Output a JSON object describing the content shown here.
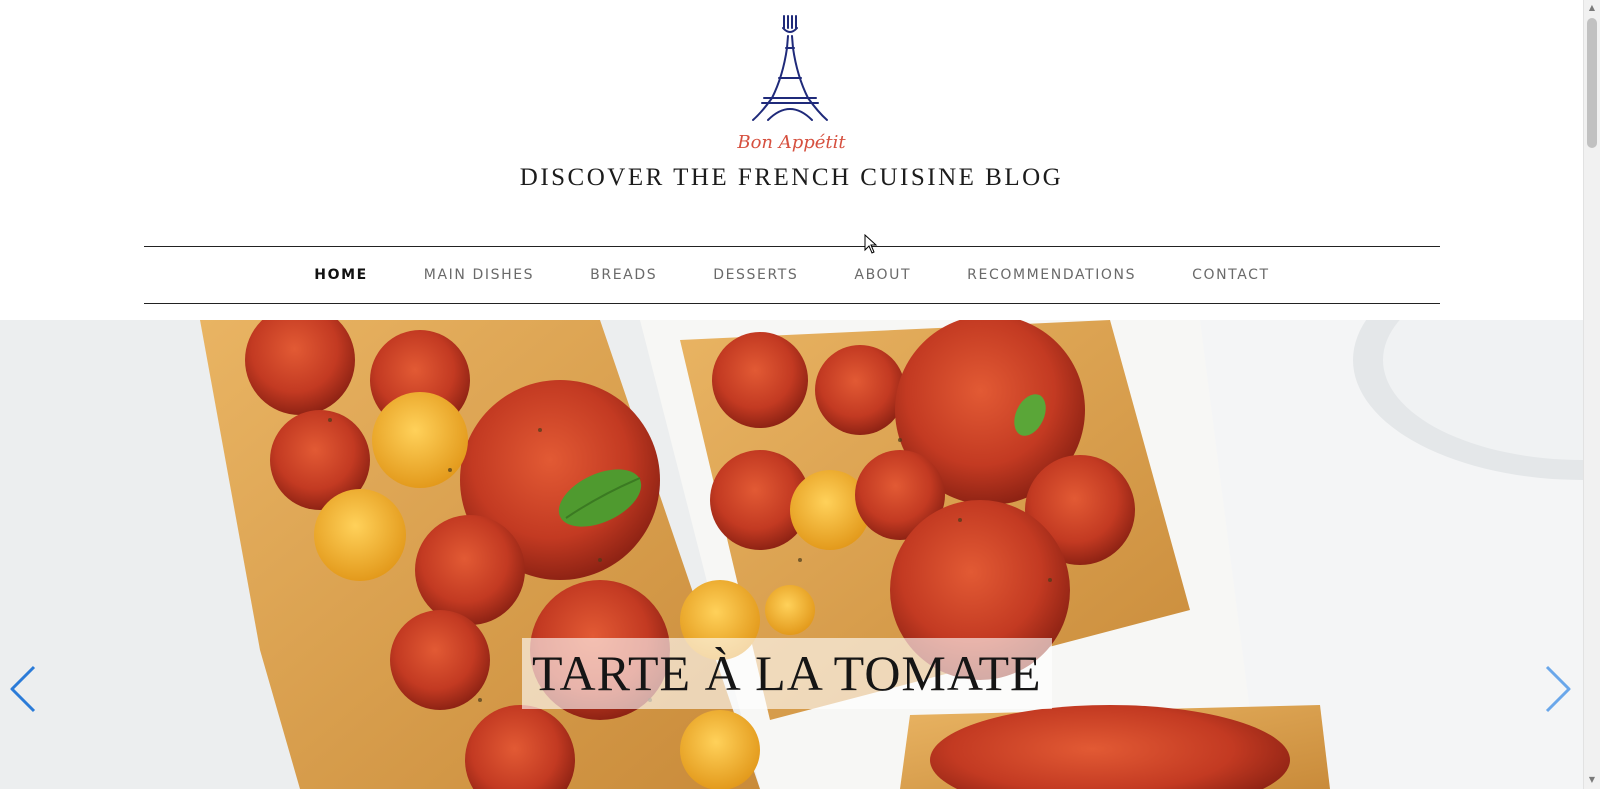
{
  "header": {
    "tagline": "Bon Appétit",
    "site_title": "DISCOVER THE FRENCH CUISINE BLOG",
    "logo_icon": "eiffel-tower-fork-icon"
  },
  "nav": {
    "items": [
      {
        "label": "HOME",
        "active": true
      },
      {
        "label": "MAIN DISHES",
        "active": false
      },
      {
        "label": "BREADS",
        "active": false
      },
      {
        "label": "DESSERTS",
        "active": false
      },
      {
        "label": "ABOUT",
        "active": false
      },
      {
        "label": "RECOMMENDATIONS",
        "active": false
      },
      {
        "label": "CONTACT",
        "active": false
      }
    ]
  },
  "slider": {
    "caption": "TARTE À LA TOMATE",
    "image_subject": "tomato-tart-image",
    "prev_icon": "chevron-left-icon",
    "next_icon": "chevron-right-icon"
  },
  "colors": {
    "tagline": "#d6503f",
    "logo": "#1f2a7a",
    "slider_arrow": "#2b7bd8",
    "nav_line": "#222222"
  },
  "scrollbar": {
    "up_icon": "scroll-up-arrow-icon",
    "down_icon": "scroll-down-arrow-icon"
  }
}
